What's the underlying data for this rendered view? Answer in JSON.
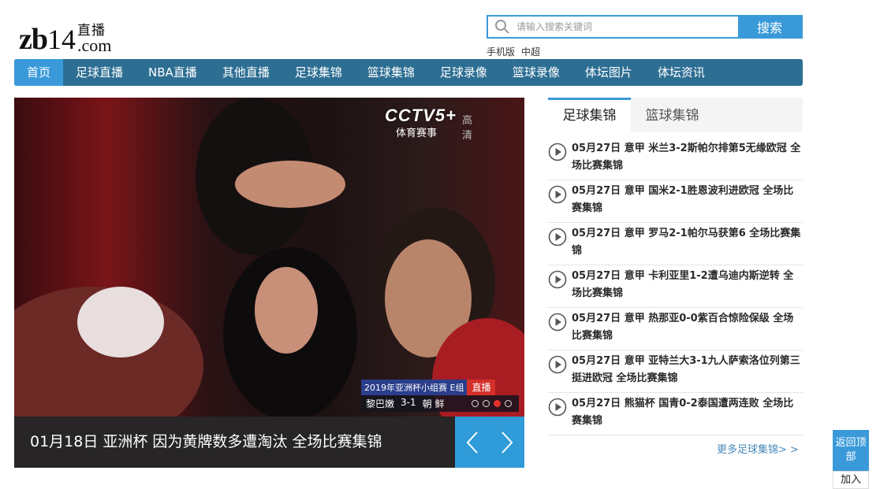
{
  "logo": {
    "zb": "zb",
    "num": "14",
    "cn": "直播",
    "com": ".com"
  },
  "search": {
    "placeholder": "请输入搜索关键词",
    "button_label": "搜索"
  },
  "mini_links": [
    "手机版",
    "中超"
  ],
  "nav": [
    "首页",
    "足球直播",
    "NBA直播",
    "其他直播",
    "足球集锦",
    "篮球集锦",
    "足球录像",
    "篮球录像",
    "体坛图片",
    "体坛资讯"
  ],
  "slider": {
    "caption": "01月18日 亚洲杯 因为黄牌数多遭淘汰 全场比赛集锦",
    "channel_logo": "CCTV5+",
    "channel_sub": "体育赛事",
    "channel_hd": "高清",
    "scoreboard": {
      "event": "2019年亚洲杯小组赛 E组",
      "live": "直播",
      "home": "黎巴嫩",
      "score": "3-1",
      "away": "朝 鲜"
    },
    "active_dot": 3
  },
  "tabs": [
    "足球集锦",
    "篮球集锦"
  ],
  "highlights": [
    {
      "date": "05月27日",
      "text": "意甲 米兰3-2斯帕尔排第5无缘欧冠 全场比赛集锦"
    },
    {
      "date": "05月27日",
      "text": "意甲 国米2-1胜恩波利进欧冠 全场比赛集锦"
    },
    {
      "date": "05月27日",
      "text": "意甲 罗马2-1帕尔马获第6 全场比赛集锦"
    },
    {
      "date": "05月27日",
      "text": "意甲 卡利亚里1-2遭乌迪内斯逆转 全场比赛集锦"
    },
    {
      "date": "05月27日",
      "text": "意甲 热那亚0-0紫百合惊险保级 全场比赛集锦"
    },
    {
      "date": "05月27日",
      "text": "意甲 亚特兰大3-1九人萨索洛位列第三挺进欧冠 全场比赛集锦"
    },
    {
      "date": "05月27日",
      "text": "熊猫杯 国青0-2泰国遭两连败 全场比赛集锦"
    }
  ],
  "more_label": "更多足球集锦> >",
  "back_top_label": "返回顶部",
  "join_label": "加入",
  "colors": {
    "accent": "#3a9ad9",
    "nav_bg": "#2d6e93",
    "live_red": "#d4302a"
  }
}
